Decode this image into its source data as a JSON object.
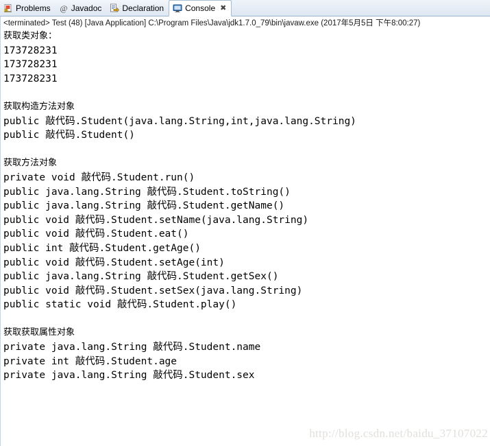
{
  "tabs": [
    {
      "label": "Problems",
      "icon": "problems-icon",
      "active": false,
      "closable": false
    },
    {
      "label": "Javadoc",
      "icon": "javadoc-at-icon",
      "active": false,
      "closable": false
    },
    {
      "label": "Declaration",
      "icon": "declaration-icon",
      "active": false,
      "closable": false
    },
    {
      "label": "Console",
      "icon": "console-icon",
      "active": true,
      "closable": true,
      "close_glyph": "✖"
    }
  ],
  "launch": {
    "text": "<terminated> Test (48) [Java Application] C:\\Program Files\\Java\\jdk1.7.0_79\\bin\\javaw.exe (2017年5月5日 下午8:00:27)"
  },
  "console_output": [
    "获取类对象：",
    "173728231",
    "173728231",
    "173728231",
    "",
    "获取构造方法对象",
    "public 敲代码.Student(java.lang.String,int,java.lang.String)",
    "public 敲代码.Student()",
    "",
    "获取方法对象",
    "private void 敲代码.Student.run()",
    "public java.lang.String 敲代码.Student.toString()",
    "public java.lang.String 敲代码.Student.getName()",
    "public void 敲代码.Student.setName(java.lang.String)",
    "public void 敲代码.Student.eat()",
    "public int 敲代码.Student.getAge()",
    "public void 敲代码.Student.setAge(int)",
    "public java.lang.String 敲代码.Student.getSex()",
    "public void 敲代码.Student.setSex(java.lang.String)",
    "public static void 敲代码.Student.play()",
    "",
    "获取获取属性对象",
    "private java.lang.String 敲代码.Student.name",
    "private int 敲代码.Student.age",
    "private java.lang.String 敲代码.Student.sex"
  ],
  "header_lines": [
    0,
    5,
    9,
    21
  ],
  "watermark": "http://blog.csdn.net/baidu_37107022",
  "colors": {
    "tab_active_bg": "#ffffff",
    "tabbar_bg": "#e8eef6",
    "console_text": "#000000",
    "watermark": "#e3e0dc"
  }
}
